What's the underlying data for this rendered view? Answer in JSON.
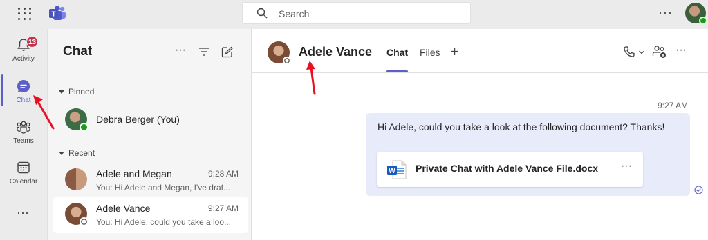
{
  "topbar": {
    "search_placeholder": "Search",
    "more_label": "···"
  },
  "rail": {
    "items": [
      {
        "label": "Activity",
        "icon": "bell-icon",
        "badge": "13"
      },
      {
        "label": "Chat",
        "icon": "chat-icon"
      },
      {
        "label": "Teams",
        "icon": "teams-icon"
      },
      {
        "label": "Calendar",
        "icon": "calendar-icon"
      }
    ],
    "more_label": "···",
    "accent": "#5b5fc7"
  },
  "chatlist": {
    "title": "Chat",
    "more_label": "···",
    "pinned_label": "Pinned",
    "recent_label": "Recent",
    "pinned": [
      {
        "name": "Debra Berger (You)"
      }
    ],
    "recent": [
      {
        "name": "Adele and Megan",
        "time": "9:28 AM",
        "preview": "You: Hi Adele and Megan, I've draf..."
      },
      {
        "name": "Adele Vance",
        "time": "9:27 AM",
        "preview": "You: Hi Adele, could you take a loo..."
      }
    ]
  },
  "conversation": {
    "name": "Adele Vance",
    "tabs": [
      "Chat",
      "Files"
    ],
    "add_tab": "+",
    "more_label": "···",
    "message": {
      "time": "9:27 AM",
      "text": "Hi Adele, could you take a look at the following document? Thanks!",
      "attachment": {
        "filename": "Private Chat with Adele Vance File.docx",
        "more_label": "···"
      }
    }
  }
}
